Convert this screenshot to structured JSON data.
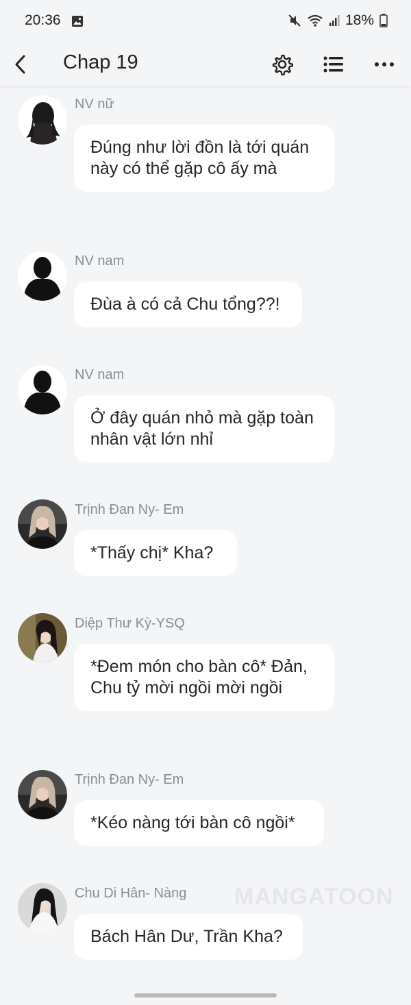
{
  "status_bar": {
    "time": "20:36",
    "battery": "18%"
  },
  "header": {
    "title": "Chap 19"
  },
  "messages": [
    {
      "name": "NV nữ",
      "avatar": "female-silhouette-avatar",
      "text": "Đúng như lời đồn là tới quán này có thể gặp cô ấy mà"
    },
    {
      "name": "NV nam",
      "avatar": "male-silhouette-avatar",
      "text": "Đùa à có cả Chu tổng??!"
    },
    {
      "name": "NV nam",
      "avatar": "male-silhouette-avatar",
      "text": "Ở đây quán nhỏ mà gặp toàn nhân vật lớn nhỉ"
    },
    {
      "name": "Trịnh Đan Ny- Em",
      "avatar": "photo-avatar",
      "text": "*Thấy chị* Kha?"
    },
    {
      "name": "Diệp Thư Kỳ-YSQ",
      "avatar": "photo-avatar",
      "text": "*Đem món cho bàn cô* Đản, Chu tỷ mời ngồi mời ngồi"
    },
    {
      "name": "Trịnh Đan Ny- Em",
      "avatar": "photo-avatar",
      "text": "*Kéo nàng tới bàn cô ngồi*"
    },
    {
      "name": "Chu Di Hân- Nàng",
      "avatar": "photo-avatar",
      "text": "Bách Hân Dư, Trần Kha?"
    }
  ],
  "watermark": "MANGATOON"
}
